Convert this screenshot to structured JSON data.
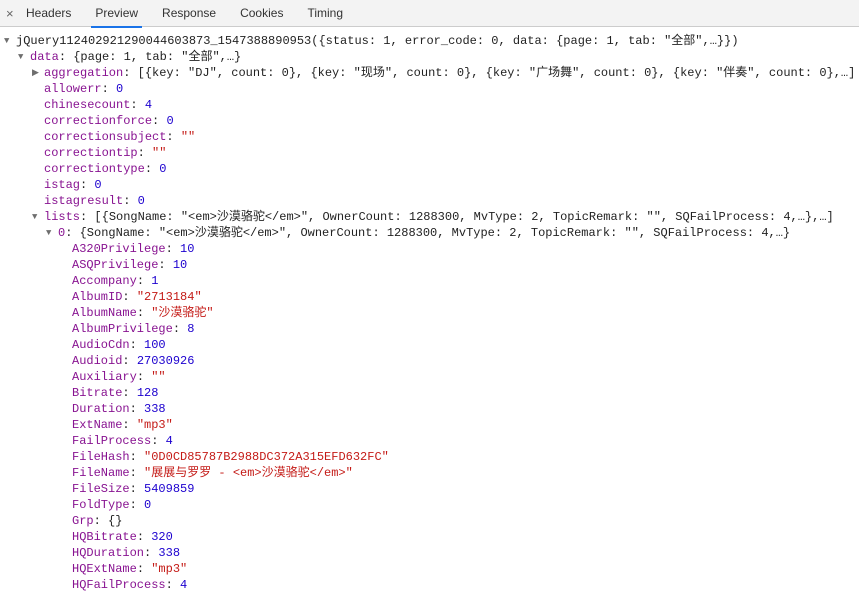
{
  "tabs": {
    "headers": "Headers",
    "preview": "Preview",
    "response": "Response",
    "cookies": "Cookies",
    "timing": "Timing"
  },
  "root_line": "jQuery112402921290044603873_1547388890953({status: 1, error_code: 0, data: {page: 1, tab: \"全部\",…}})",
  "data_summary_label": "data",
  "data_summary_value": "{page: 1, tab: \"全部\",…}",
  "aggregation_label": "aggregation",
  "aggregation_value": "[{key: \"DJ\", count: 0}, {key: \"现场\", count: 0}, {key: \"广场舞\", count: 0}, {key: \"伴奏\", count: 0},…]",
  "data_top": [
    {
      "k": "allowerr",
      "v": "0",
      "t": "num"
    },
    {
      "k": "chinesecount",
      "v": "4",
      "t": "num"
    },
    {
      "k": "correctionforce",
      "v": "0",
      "t": "num"
    },
    {
      "k": "correctionsubject",
      "v": "\"\"",
      "t": "str"
    },
    {
      "k": "correctiontip",
      "v": "\"\"",
      "t": "str"
    },
    {
      "k": "correctiontype",
      "v": "0",
      "t": "num"
    },
    {
      "k": "istag",
      "v": "0",
      "t": "num"
    },
    {
      "k": "istagresult",
      "v": "0",
      "t": "num"
    }
  ],
  "lists_label": "lists",
  "lists_summary": "[{SongName: \"<em>沙漠骆驼</em>\", OwnerCount: 1288300, MvType: 2, TopicRemark: \"\", SQFailProcess: 4,…},…]",
  "item0_label": "0",
  "item0_summary": "{SongName: \"<em>沙漠骆驼</em>\", OwnerCount: 1288300, MvType: 2, TopicRemark: \"\", SQFailProcess: 4,…}",
  "item0_fields": [
    {
      "k": "A320Privilege",
      "v": "10",
      "t": "num"
    },
    {
      "k": "ASQPrivilege",
      "v": "10",
      "t": "num"
    },
    {
      "k": "Accompany",
      "v": "1",
      "t": "num"
    },
    {
      "k": "AlbumID",
      "v": "\"2713184\"",
      "t": "str"
    },
    {
      "k": "AlbumName",
      "v": "\"沙漠骆驼\"",
      "t": "str"
    },
    {
      "k": "AlbumPrivilege",
      "v": "8",
      "t": "num"
    },
    {
      "k": "AudioCdn",
      "v": "100",
      "t": "num"
    },
    {
      "k": "Audioid",
      "v": "27030926",
      "t": "num"
    },
    {
      "k": "Auxiliary",
      "v": "\"\"",
      "t": "str"
    },
    {
      "k": "Bitrate",
      "v": "128",
      "t": "num"
    },
    {
      "k": "Duration",
      "v": "338",
      "t": "num"
    },
    {
      "k": "ExtName",
      "v": "\"mp3\"",
      "t": "str"
    },
    {
      "k": "FailProcess",
      "v": "4",
      "t": "num"
    },
    {
      "k": "FileHash",
      "v": "\"0D0CD85787B2988DC372A315EFD632FC\"",
      "t": "str"
    },
    {
      "k": "FileName",
      "v": "\"展展与罗罗 - <em>沙漠骆驼</em>\"",
      "t": "str"
    },
    {
      "k": "FileSize",
      "v": "5409859",
      "t": "num"
    },
    {
      "k": "FoldType",
      "v": "0",
      "t": "num"
    },
    {
      "k": "Grp",
      "v": "{}",
      "t": "plain"
    },
    {
      "k": "HQBitrate",
      "v": "320",
      "t": "num"
    },
    {
      "k": "HQDuration",
      "v": "338",
      "t": "num"
    },
    {
      "k": "HQExtName",
      "v": "\"mp3\"",
      "t": "str"
    },
    {
      "k": "HQFailProcess",
      "v": "4",
      "t": "num"
    }
  ]
}
